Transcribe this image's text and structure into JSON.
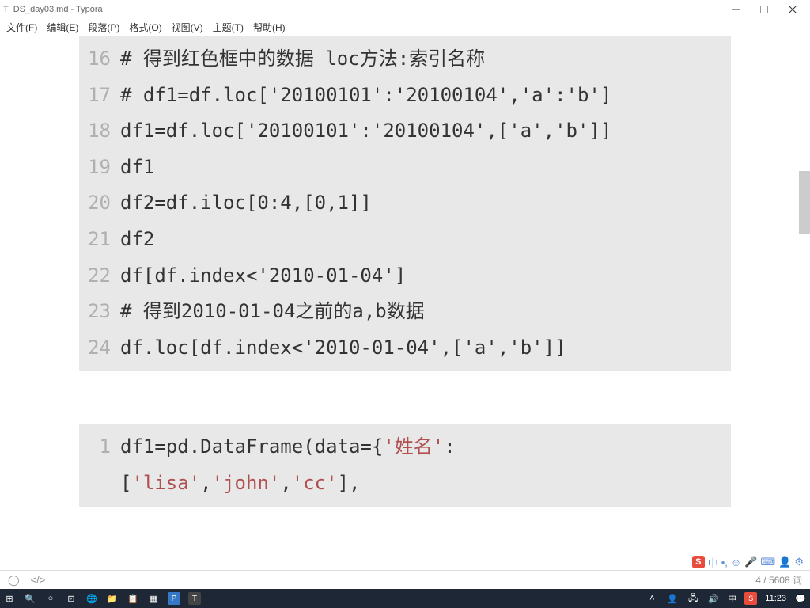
{
  "window": {
    "title": "DS_day03.md - Typora",
    "icon_letter": "T"
  },
  "menu": {
    "file": "文件(F)",
    "edit": "编辑(E)",
    "para": "段落(P)",
    "format": "格式(O)",
    "view": "视图(V)",
    "theme": "主题(T)",
    "help": "帮助(H)"
  },
  "code1": {
    "lines": [
      {
        "n": "16",
        "t": "# 得到红色框中的数据 loc方法:索引名称",
        "cls": "comment"
      },
      {
        "n": "17",
        "t": "# df1=df.loc['20100101':'20100104','a':'b']",
        "cls": "comment"
      },
      {
        "n": "18",
        "t": "df1=df.loc['20100101':'20100104',['a','b']]",
        "cls": ""
      },
      {
        "n": "19",
        "t": "df1",
        "cls": ""
      },
      {
        "n": "20",
        "t": "df2=df.iloc[0:4,[0,1]]",
        "cls": ""
      },
      {
        "n": "21",
        "t": "df2",
        "cls": ""
      },
      {
        "n": "22",
        "t": "df[df.index<'2010-01-04']",
        "cls": ""
      },
      {
        "n": "23",
        "t": "# 得到2010-01-04之前的a,b数据",
        "cls": "comment"
      },
      {
        "n": "24",
        "t": "df.loc[df.index<'2010-01-04',['a','b']]",
        "cls": ""
      }
    ]
  },
  "code2": {
    "ln": "1",
    "prefix": "df1=pd.DataFrame(data={",
    "key1": "'姓名'",
    "colon": ":",
    "list_open": "[",
    "v1": "'lisa'",
    "c1": ",",
    "v2": "'john'",
    "c2": ",",
    "v3": "'cc'",
    "list_close": "],"
  },
  "status": {
    "words": "4 / 5608 词"
  },
  "ime": {
    "logo": "S",
    "lang": "中"
  },
  "taskbar": {
    "time": "11:23",
    "lang": "中"
  }
}
